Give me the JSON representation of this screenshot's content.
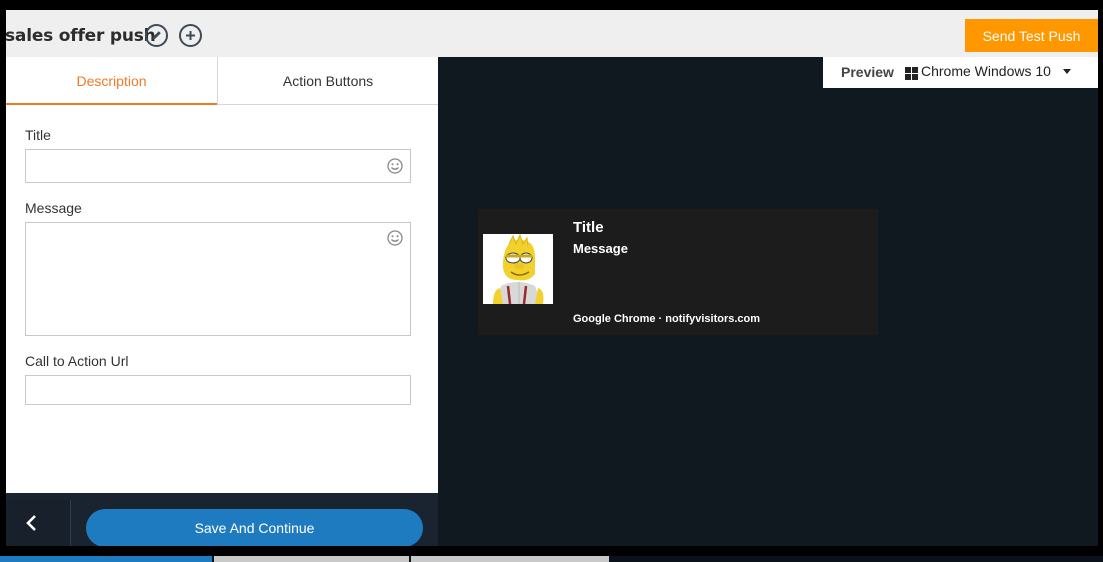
{
  "header": {
    "title": "sales offer push",
    "send_test_label": "Send Test Push"
  },
  "tabs": [
    {
      "label": "Description",
      "active": true
    },
    {
      "label": "Action Buttons",
      "active": false
    }
  ],
  "form": {
    "title_label": "Title",
    "title_value": "",
    "message_label": "Message",
    "message_value": "",
    "url_label": "Call to Action Url",
    "url_value": ""
  },
  "footer": {
    "save_label": "Save And Continue"
  },
  "preview": {
    "label": "Preview",
    "browser": "Chrome Windows 10"
  },
  "notification": {
    "title": "Title",
    "message": "Message",
    "source": "Google Chrome · notifyvisitors.com"
  },
  "colors": {
    "accent": "#ff9800",
    "tab_active": "#f07a2a",
    "primary_button": "#1f7bc0",
    "dark_bg": "#101820"
  }
}
